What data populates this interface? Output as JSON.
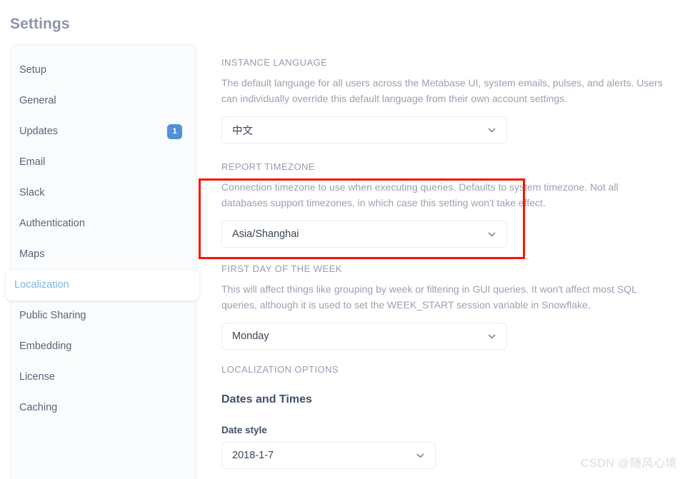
{
  "page": {
    "title": "Settings",
    "watermark": "CSDN @随风心境"
  },
  "sidebar": {
    "items": [
      {
        "label": "Setup",
        "badge": null,
        "active": false
      },
      {
        "label": "General",
        "badge": null,
        "active": false
      },
      {
        "label": "Updates",
        "badge": "1",
        "active": false
      },
      {
        "label": "Email",
        "badge": null,
        "active": false
      },
      {
        "label": "Slack",
        "badge": null,
        "active": false
      },
      {
        "label": "Authentication",
        "badge": null,
        "active": false
      },
      {
        "label": "Maps",
        "badge": null,
        "active": false
      },
      {
        "label": "Localization",
        "badge": null,
        "active": true
      },
      {
        "label": "Public Sharing",
        "badge": null,
        "active": false
      },
      {
        "label": "Embedding",
        "badge": null,
        "active": false
      },
      {
        "label": "License",
        "badge": null,
        "active": false
      },
      {
        "label": "Caching",
        "badge": null,
        "active": false
      }
    ]
  },
  "main": {
    "instance_language": {
      "heading": "INSTANCE LANGUAGE",
      "description": "The default language for all users across the Metabase UI, system emails, pulses, and alerts. Users can individually override this default language from their own account settings.",
      "value": "中文",
      "chevron_icon": "chevron-down-icon"
    },
    "report_timezone": {
      "heading": "REPORT TIMEZONE",
      "description": "Connection timezone to use when executing queries. Defaults to system timezone. Not all databases support timezones, in which case this setting won't take effect.",
      "value": "Asia/Shanghai",
      "chevron_icon": "chevron-down-icon"
    },
    "first_day_of_week": {
      "heading": "FIRST DAY OF THE WEEK",
      "description": "This will affect things like grouping by week or filtering in GUI queries. It won't affect most SQL queries, although it is used to set the WEEK_START session variable in Snowflake.",
      "value": "Monday",
      "chevron_icon": "chevron-down-icon"
    },
    "localization_options": {
      "heading": "LOCALIZATION OPTIONS",
      "dates_and_times_title": "Dates and Times",
      "date_style_label": "Date style",
      "date_style_value": "2018-1-7",
      "chevron_icon": "chevron-down-icon"
    }
  },
  "annotation": {
    "name": "red-highlight-box",
    "color": "#fb1302"
  },
  "colors": {
    "accent_blue": "#5191d6",
    "active_text": "#7cb4ea",
    "heading_gray": "#949cb0",
    "body_gray": "#9aa1b1",
    "sidebar_bg": "#f9fbfc",
    "annotation_red": "#fb1302"
  }
}
